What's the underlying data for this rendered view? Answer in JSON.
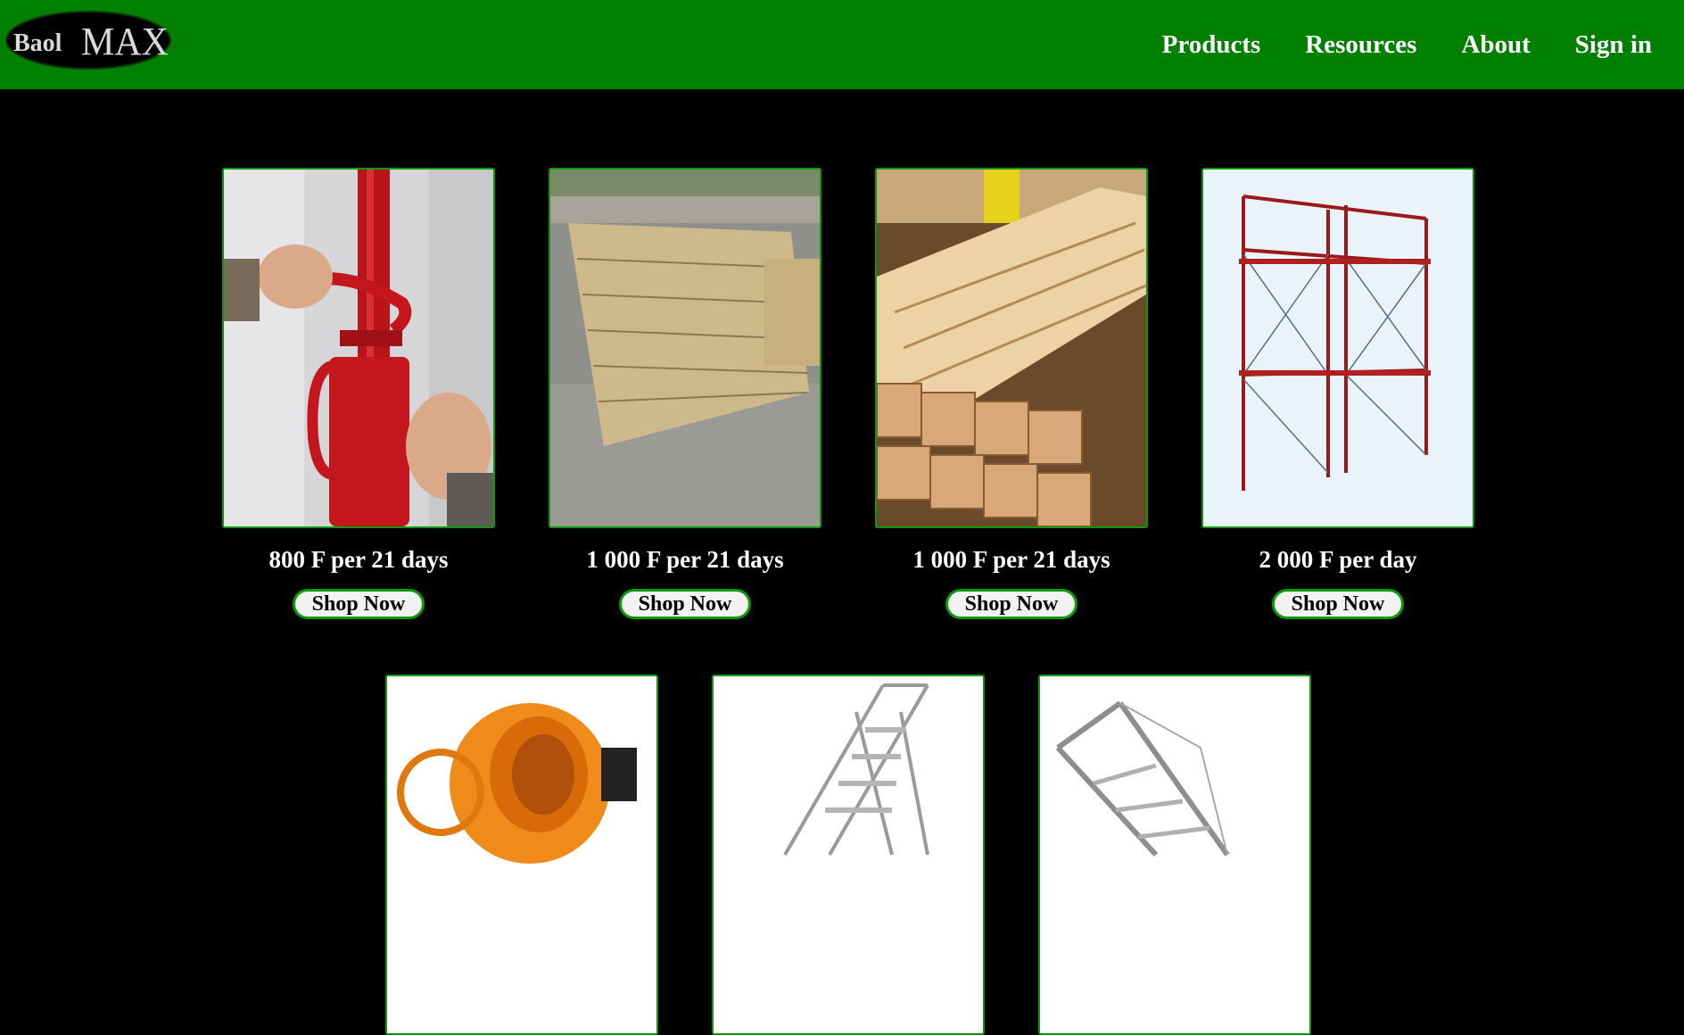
{
  "header": {
    "logo_text": "BaolMAX",
    "nav": [
      {
        "label": "Products"
      },
      {
        "label": "Resources"
      },
      {
        "label": "About"
      },
      {
        "label": "Sign in"
      }
    ]
  },
  "colors": {
    "header_bg": "#008000",
    "page_bg": "#000000",
    "card_border": "#0a9a0a",
    "button_bg": "#f2f2f2"
  },
  "products": [
    {
      "image": "adjustable-steel-prop-image",
      "price": "800 F per 21 days",
      "button": "Shop Now"
    },
    {
      "image": "stacked-planks-image",
      "price": "1 000 F per 21 days",
      "button": "Shop Now"
    },
    {
      "image": "timber-beams-image",
      "price": "1 000 F per 21 days",
      "button": "Shop Now"
    },
    {
      "image": "scaffolding-image",
      "price": "2 000 F per day",
      "button": "Shop Now"
    },
    {
      "image": "concrete-mixer-image"
    },
    {
      "image": "rolling-stair-platform-image"
    },
    {
      "image": "aluminium-ladder-image"
    }
  ]
}
